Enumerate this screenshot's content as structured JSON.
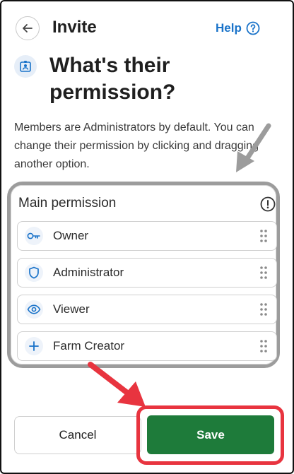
{
  "header": {
    "title": "Invite",
    "help_label": "Help",
    "back_icon": "back-arrow-icon",
    "help_icon": "help-circle-icon"
  },
  "page": {
    "title": "What's their permission?",
    "icon": "id-badge-icon",
    "description": "Members are Administrators by default. You can change their permission by clicking and dragging another option."
  },
  "permission_group": {
    "label": "Main permission",
    "info_icon": "info-icon",
    "items": [
      {
        "label": "Owner",
        "icon": "key-icon"
      },
      {
        "label": "Administrator",
        "icon": "shield-icon"
      },
      {
        "label": "Viewer",
        "icon": "eye-icon"
      },
      {
        "label": "Farm Creator",
        "icon": "plus-icon"
      }
    ]
  },
  "footer": {
    "cancel_label": "Cancel",
    "save_label": "Save"
  },
  "colors": {
    "accent_blue": "#1a73c9",
    "save_green": "#1e7b3a",
    "highlight_red": "#e8343f",
    "annotation_gray": "#9c9c9c"
  }
}
